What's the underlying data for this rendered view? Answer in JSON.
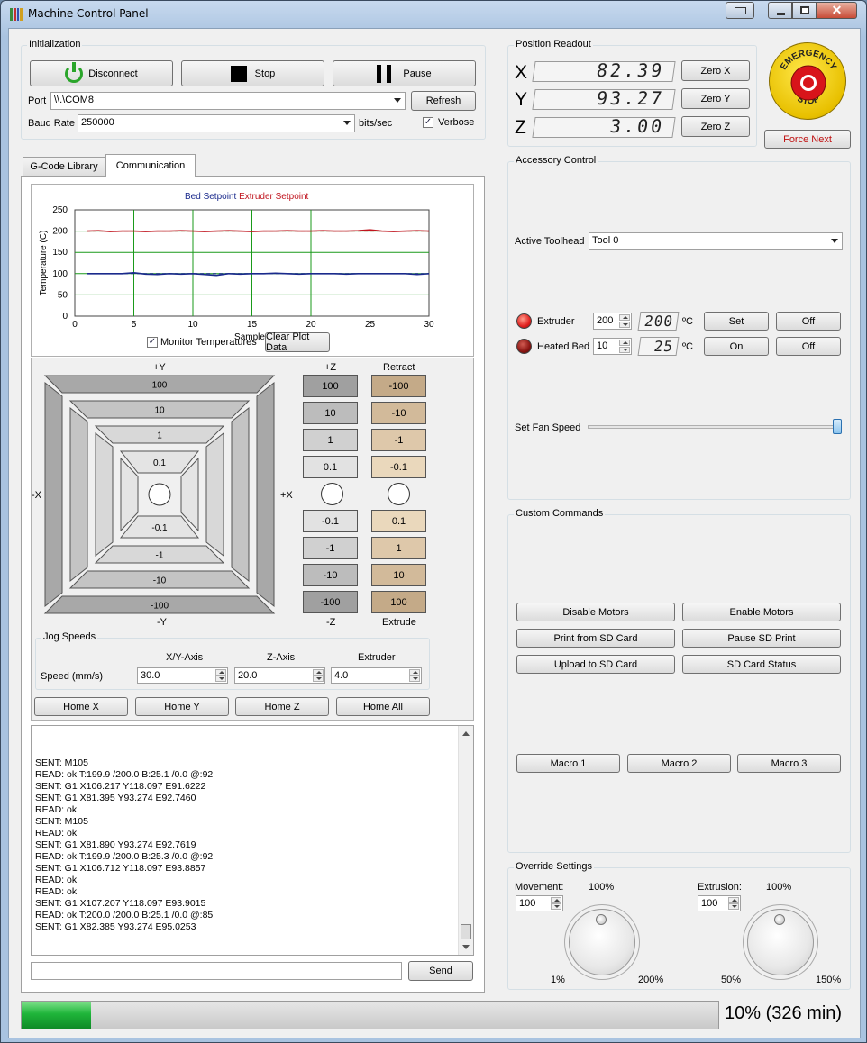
{
  "window": {
    "title": "Machine Control Panel"
  },
  "init": {
    "title": "Initialization",
    "disconnect": "Disconnect",
    "stop": "Stop",
    "pause": "Pause",
    "port_label": "Port",
    "port_value": "\\\\.\\COM8",
    "refresh": "Refresh",
    "baud_label": "Baud Rate",
    "baud_value": "250000",
    "baud_unit": "bits/sec",
    "verbose": "Verbose"
  },
  "position": {
    "title": "Position Readout",
    "x_label": "X",
    "x_value": "82.39",
    "zero_x": "Zero X",
    "y_label": "Y",
    "y_value": "93.27",
    "zero_y": "Zero Y",
    "z_label": "Z",
    "z_value": "3.00",
    "zero_z": "Zero Z"
  },
  "estop": {
    "text": "EMERGENCY STOP",
    "force_next": "Force Next"
  },
  "tabs": [
    "G-Code Library",
    "Communication"
  ],
  "plot": {
    "legend": [
      "Bed",
      "Setpoint",
      "Extruder",
      "Setpoint"
    ],
    "ylabel": "Temperature (C)",
    "xlabel": "Samples",
    "monitor": "Monitor Temperatures",
    "clear": "Clear Plot Data"
  },
  "chart_data": {
    "type": "line",
    "xlabel": "Samples",
    "ylabel": "Temperature (C)",
    "xlim": [
      0,
      30
    ],
    "ylim": [
      0,
      250
    ],
    "xticks": [
      0,
      5,
      10,
      15,
      20,
      25,
      30
    ],
    "yticks": [
      0,
      50,
      100,
      150,
      200,
      250
    ],
    "series": [
      {
        "name": "Bed",
        "color": "#1a2a8c",
        "x": [
          1,
          2,
          3,
          4,
          5,
          6,
          7,
          8,
          9,
          10,
          11,
          12,
          13,
          14,
          15,
          16,
          17,
          18,
          19,
          20,
          21,
          22,
          23,
          24,
          25,
          26,
          27,
          28,
          29,
          30
        ],
        "values": [
          100,
          100,
          100,
          100,
          102,
          99,
          98,
          100,
          99,
          100,
          98,
          96,
          100,
          99,
          100,
          100,
          101,
          100,
          99,
          100,
          100,
          100,
          99,
          100,
          100,
          100,
          100,
          100,
          98,
          100
        ]
      },
      {
        "name": "Setpoint",
        "color": "#1a2a8c",
        "dashed": true,
        "x": [
          1,
          30
        ],
        "values": [
          100,
          100
        ]
      },
      {
        "name": "Extruder",
        "color": "#c0141e",
        "x": [
          1,
          2,
          3,
          4,
          5,
          6,
          7,
          8,
          9,
          10,
          11,
          12,
          13,
          14,
          15,
          16,
          17,
          18,
          19,
          20,
          21,
          22,
          23,
          24,
          25,
          26,
          27,
          28,
          29,
          30
        ],
        "values": [
          200,
          201,
          199,
          200,
          200,
          199,
          200,
          200,
          201,
          200,
          199,
          200,
          201,
          200,
          199,
          200,
          200,
          201,
          200,
          200,
          201,
          200,
          200,
          201,
          203,
          200,
          199,
          200,
          201,
          200
        ]
      },
      {
        "name": "Setpoint",
        "color": "#c0141e",
        "dashed": true,
        "x": [
          1,
          30
        ],
        "values": [
          200,
          200
        ]
      }
    ]
  },
  "jog": {
    "plus_y": "+Y",
    "minus_y": "-Y",
    "minus_x": "-X",
    "plus_x": "+X",
    "xy_labels": [
      "100",
      "10",
      "1",
      "0.1",
      "-0.1",
      "-1",
      "-10",
      "-100"
    ],
    "plus_z": "+Z",
    "minus_z": "-Z",
    "z_labels": [
      "100",
      "10",
      "1",
      "0.1",
      "-0.1",
      "-1",
      "-10",
      "-100"
    ],
    "retract": "Retract",
    "extrude": "Extrude",
    "e_labels": [
      "-100",
      "-10",
      "-1",
      "-0.1",
      "0.1",
      "1",
      "10",
      "100"
    ]
  },
  "jog_speeds": {
    "title": "Jog Speeds",
    "xy_head": "X/Y-Axis",
    "z_head": "Z-Axis",
    "e_head": "Extruder",
    "speed_label": "Speed (mm/s)",
    "xy": "30.0",
    "z": "20.0",
    "e": "4.0"
  },
  "home": {
    "x": "Home X",
    "y": "Home Y",
    "z": "Home Z",
    "all": "Home All"
  },
  "console": {
    "lines": [
      "SENT: M105",
      "READ: ok T:199.9 /200.0 B:25.1 /0.0 @:92",
      "SENT: G1 X106.217 Y118.097 E91.6222",
      "SENT: G1 X81.395 Y93.274 E92.7460",
      "READ: ok",
      "SENT: M105",
      "READ: ok",
      "SENT: G1 X81.890 Y93.274 E92.7619",
      "READ: ok T:199.9 /200.0 B:25.3 /0.0 @:92",
      "SENT: G1 X106.712 Y118.097 E93.8857",
      "READ: ok",
      "READ: ok",
      "SENT: G1 X107.207 Y118.097 E93.9015",
      "READ: ok T:200.0 /200.0 B:25.1 /0.0 @:85",
      "SENT: G1 X82.385 Y93.274 E95.0253"
    ],
    "send": "Send"
  },
  "accessory": {
    "title": "Accessory Control",
    "toolhead_label": "Active Toolhead",
    "toolhead_value": "Tool 0",
    "extruder_label": "Extruder",
    "extruder_set": "200",
    "extruder_temp": "200",
    "unit": "ºC",
    "set": "Set",
    "off": "Off",
    "bed_label": "Heated Bed",
    "bed_set": "10",
    "bed_temp": "25",
    "on": "On",
    "fan_label": "Set Fan Speed",
    "fan_level": 1.0
  },
  "custom": {
    "title": "Custom Commands",
    "buttons": [
      "Disable Motors",
      "Enable Motors",
      "Print from SD Card",
      "Pause SD Print",
      "Upload to SD Card",
      "SD Card Status"
    ],
    "macros": [
      "Macro 1",
      "Macro 2",
      "Macro 3"
    ]
  },
  "override": {
    "title": "Override Settings",
    "movement_label": "Movement:",
    "movement_pct": "100%",
    "movement_value": "100",
    "movement_min": "1%",
    "movement_max": "200%",
    "extrusion_label": "Extrusion:",
    "extrusion_pct": "100%",
    "extrusion_value": "100",
    "extrusion_min": "50%",
    "extrusion_max": "150%"
  },
  "progress": {
    "fraction": 0.1,
    "text": "10% (326 min)"
  },
  "colors": {
    "led_on": "#e0201e",
    "led_off": "#8a1512",
    "progress": "#1fb53a",
    "retract_fill": "#d8c2a0",
    "z_fill": "#c8c8c8"
  }
}
